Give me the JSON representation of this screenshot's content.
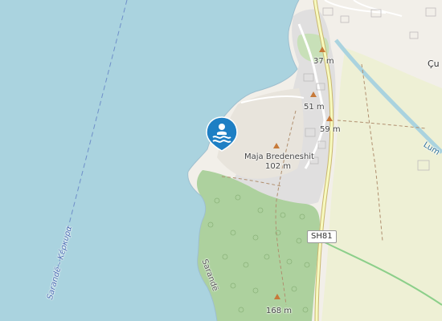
{
  "map": {
    "colors": {
      "water": "#aad3df",
      "land": "#f2efe9",
      "forest": "#add19e",
      "farmland": "#eef0d5",
      "urban": "#e0dfdf",
      "road": "#ffffff",
      "road_primary": "#f7fabf",
      "road_casing": "#c9b66f",
      "maritime_boundary": "#6f8fc9",
      "peak": "#c77a3a",
      "marker": "#1e7fc4"
    },
    "labels": {
      "ferry_route": "Sarandë - Κέρκυρα",
      "main_peak_name": "Maja Bredeneshit",
      "main_peak_elev": "102 m",
      "peak_37": "37 m",
      "peak_51": "51 m",
      "peak_59": "59 m",
      "peak_168": "168 m",
      "coast_name": "Sarandë",
      "road_ref": "SH81",
      "town_partial": "Çu",
      "canal_partial": "Lum"
    },
    "marker": {
      "type": "swimming-beach",
      "icon": "swimmer-icon"
    }
  }
}
